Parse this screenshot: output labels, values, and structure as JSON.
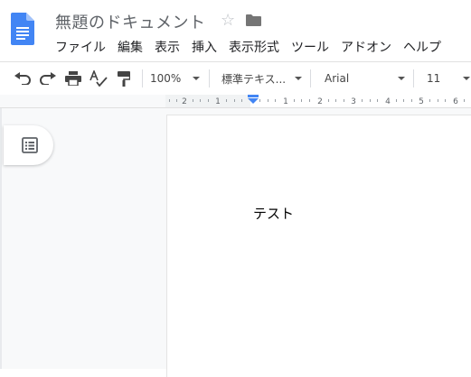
{
  "document": {
    "title": "無題のドキュメント",
    "body_text": "テスト"
  },
  "menu": [
    "ファイル",
    "編集",
    "表示",
    "挿入",
    "表示形式",
    "ツール",
    "アドオン",
    "ヘルプ"
  ],
  "toolbar": {
    "zoom": "100%",
    "paragraph_style": "標準テキス...",
    "font": "Arial",
    "font_size": "11"
  },
  "ruler": {
    "left_numbers": [
      "2",
      "1"
    ],
    "right_numbers": [
      "1",
      "2",
      "3",
      "4",
      "5",
      "6"
    ]
  },
  "colors": {
    "docs_blue": "#4285f4",
    "toolbar_icon": "#444444",
    "ruler_marker": "#4285f4"
  },
  "icons": {
    "app": "google-docs-icon",
    "star": "star-outline-icon",
    "folder": "folder-icon",
    "undo": "undo-icon",
    "redo": "redo-icon",
    "print": "print-icon",
    "spellcheck": "spellcheck-icon",
    "paint_format": "paint-format-icon",
    "outline": "document-outline-icon"
  }
}
